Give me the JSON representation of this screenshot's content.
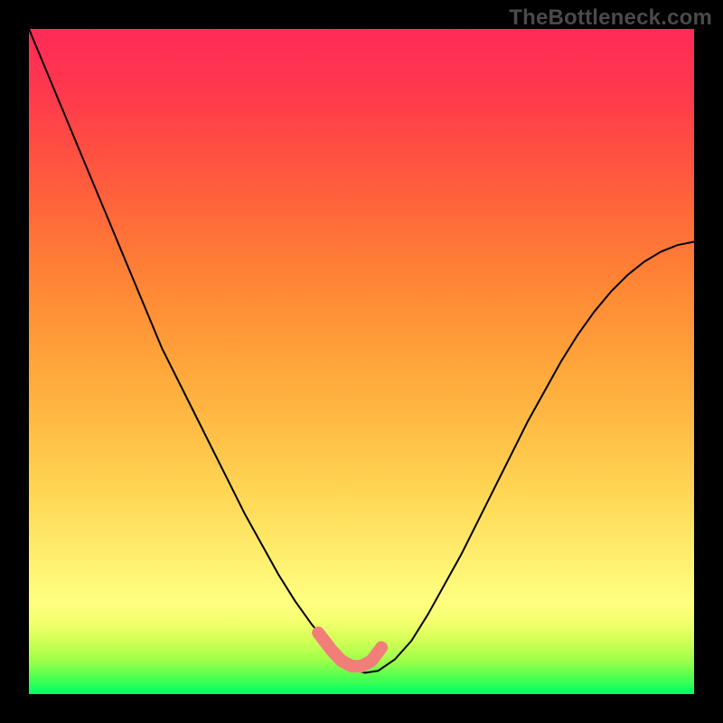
{
  "watermark": {
    "text": "TheBottleneck.com"
  },
  "chart_data": {
    "type": "line",
    "title": "",
    "xlabel": "",
    "ylabel": "",
    "xlim": [
      0,
      100
    ],
    "ylim": [
      0,
      100
    ],
    "grid": false,
    "background_gradient": {
      "orientation": "vertical",
      "stops": [
        {
          "pos": 0,
          "color": "#ff2a58"
        },
        {
          "pos": 50,
          "color": "#ffa43a"
        },
        {
          "pos": 86,
          "color": "#ffff80"
        },
        {
          "pos": 100,
          "color": "#00ff66"
        }
      ]
    },
    "series": [
      {
        "name": "bottleneck-curve",
        "color": "#000000",
        "stroke_width": 2,
        "x": [
          0,
          2.5,
          5,
          7.5,
          10,
          12.5,
          15,
          17.5,
          20,
          22.5,
          25,
          27.5,
          30,
          32.5,
          35,
          37.5,
          40,
          42.5,
          45,
          46.5,
          48.5,
          50.5,
          52.5,
          55,
          57.5,
          60,
          62.5,
          65,
          67.5,
          70,
          72.5,
          75,
          77.5,
          80,
          82.5,
          85,
          87.5,
          90,
          92.5,
          95,
          97.5,
          100
        ],
        "values": [
          100,
          94,
          88,
          82,
          76,
          70,
          64,
          58,
          52,
          47,
          42,
          37,
          32,
          27,
          22.5,
          18,
          14,
          10.5,
          7.5,
          5.5,
          3.8,
          3.2,
          3.5,
          5.2,
          8,
          12,
          16.5,
          21,
          26,
          31,
          36,
          41,
          45.5,
          50,
          54,
          57.5,
          60.5,
          63,
          65,
          66.5,
          67.5,
          68
        ]
      },
      {
        "name": "min-highlight",
        "color": "#f27e7a",
        "stroke_width": 14,
        "x": [
          43.5,
          45.5,
          47,
          48.5,
          50,
          51.5,
          53
        ],
        "values": [
          9.2,
          6.6,
          5.0,
          4.2,
          4.2,
          5.0,
          7.0
        ]
      }
    ]
  }
}
